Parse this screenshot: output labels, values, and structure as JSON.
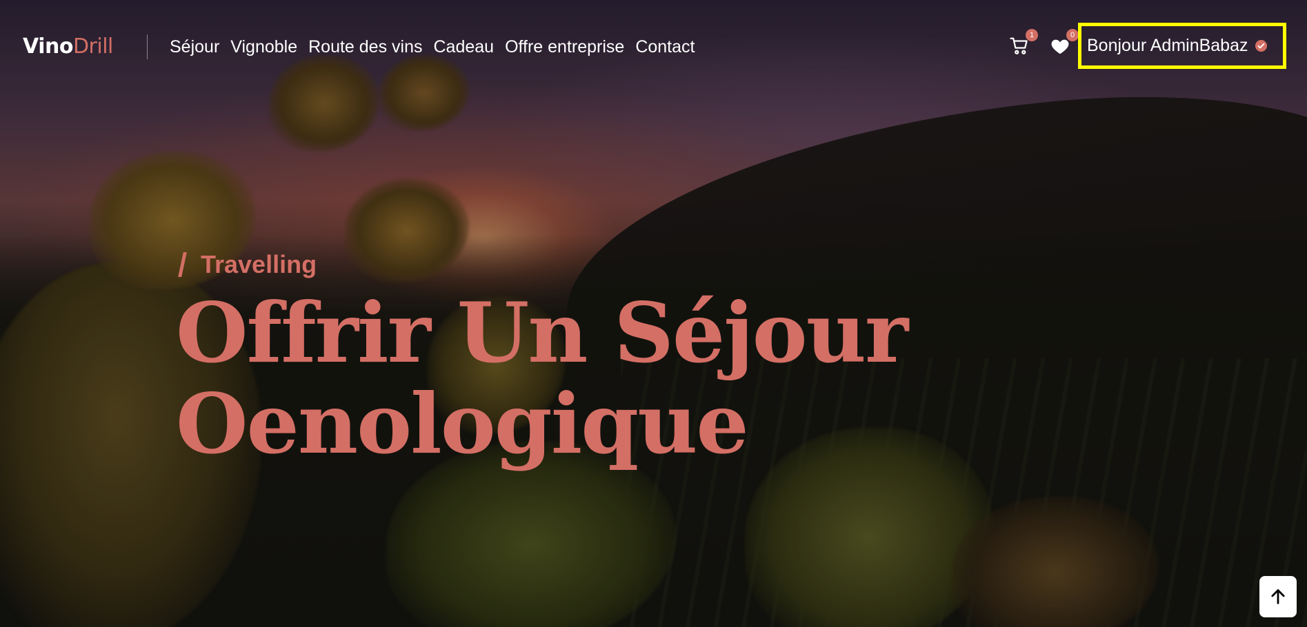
{
  "header": {
    "logo_part1": "Vino",
    "logo_part2": "Drill",
    "nav": [
      "Séjour",
      "Vignoble",
      "Route des vins",
      "Cadeau",
      "Offre entreprise",
      "Contact"
    ],
    "cart": {
      "icon": "cart-icon",
      "count": "1"
    },
    "wishlist": {
      "icon": "heart-icon",
      "count": "0"
    },
    "user_greeting": "Bonjour AdminBabaz",
    "user_status_icon": "check-circle-icon"
  },
  "hero": {
    "eyebrow": "Travelling",
    "title": "Offrir Un Séjour Oenologique"
  },
  "scroll_top": {
    "icon": "arrow-up-icon"
  },
  "colors": {
    "accent": "#d46f65",
    "highlight_border": "#ffff00",
    "text_light": "#ffffff"
  }
}
